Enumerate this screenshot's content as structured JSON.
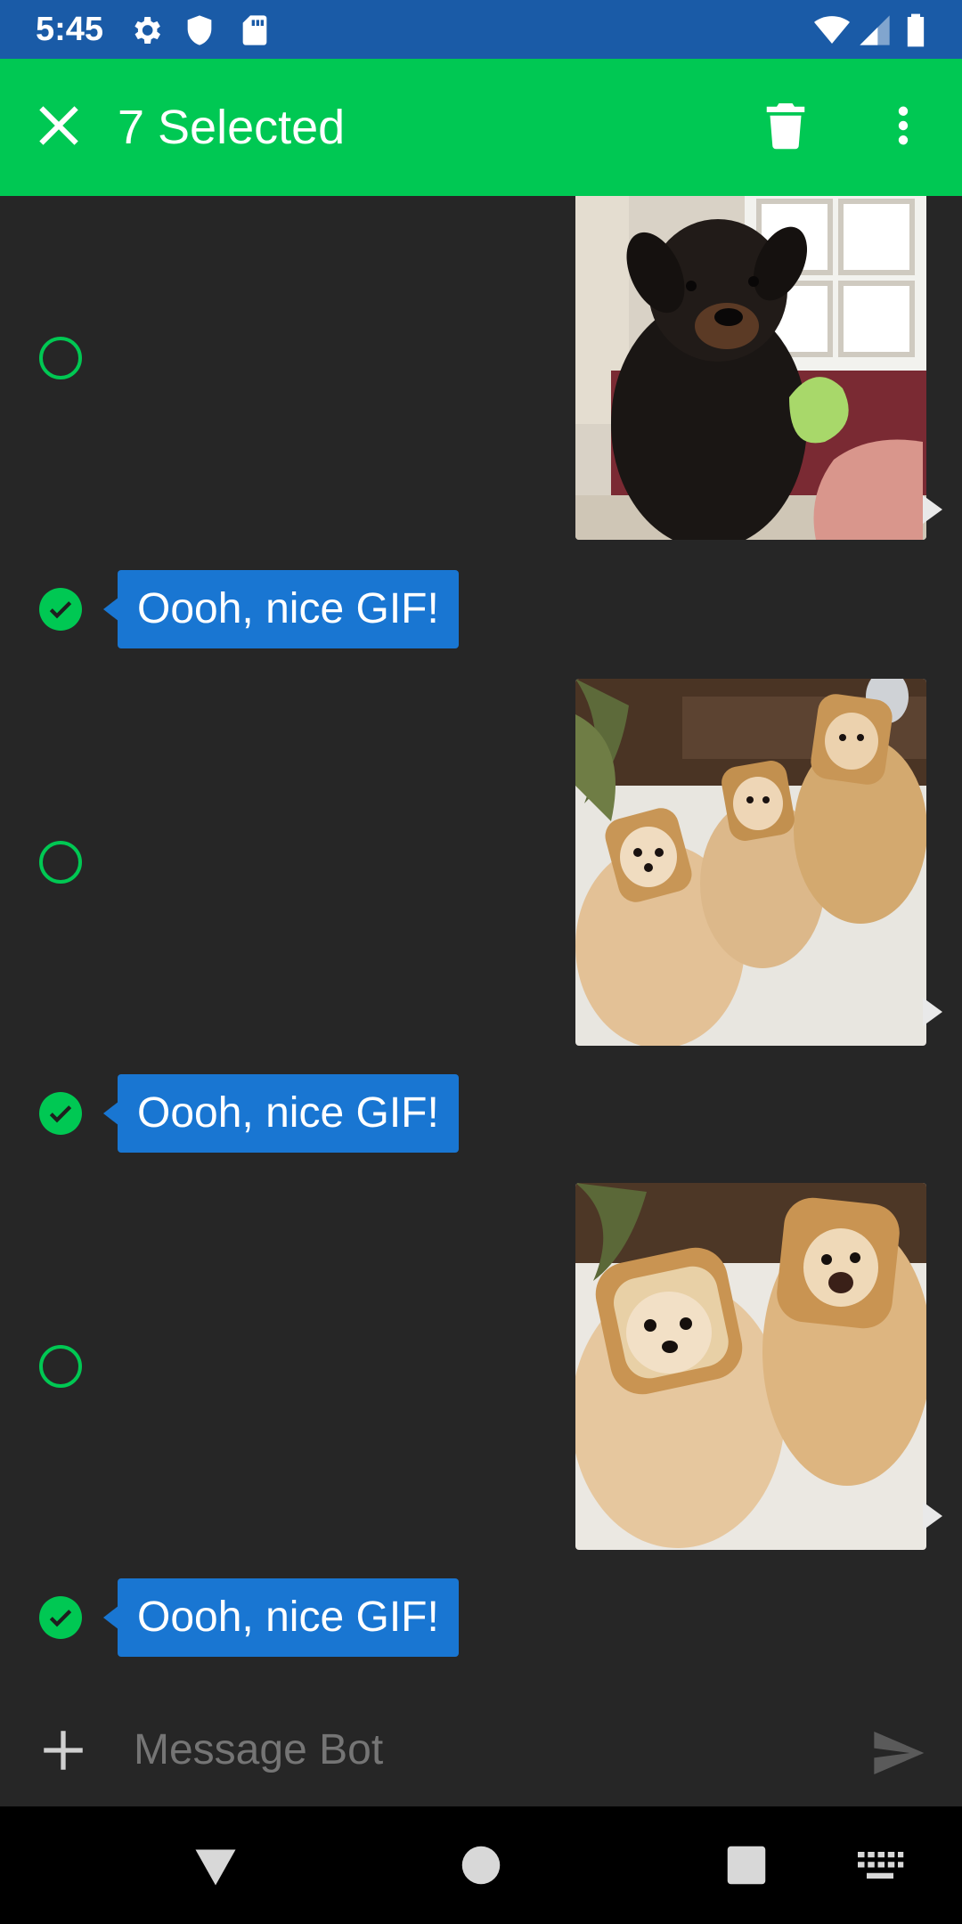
{
  "status_bar": {
    "time": "5:45",
    "icons_left": [
      "gear-icon",
      "shield-icon",
      "sd-card-icon"
    ],
    "icons_right": [
      "wifi-icon",
      "cell-signal-icon",
      "battery-icon"
    ]
  },
  "app_bar": {
    "title": "7 Selected",
    "close_icon": "close-icon",
    "delete_icon": "trash-icon",
    "overflow_icon": "more-vert-icon"
  },
  "messages": [
    {
      "type": "gif",
      "description": "rottweiler-gif",
      "selected": false
    },
    {
      "type": "text",
      "text": "Oooh, nice GIF!",
      "selected": true
    },
    {
      "type": "gif",
      "description": "pomeranians-bread-gif",
      "selected": false
    },
    {
      "type": "text",
      "text": "Oooh, nice GIF!",
      "selected": true
    },
    {
      "type": "gif",
      "description": "pomeranians-bread-gif",
      "selected": false
    },
    {
      "type": "text",
      "text": "Oooh, nice GIF!",
      "selected": true
    }
  ],
  "compose": {
    "placeholder": "Message Bot"
  },
  "colors": {
    "accent_green": "#00c853",
    "status_bar_blue": "#1a5ba7",
    "bubble_blue": "#1976d2",
    "background": "#262626"
  }
}
